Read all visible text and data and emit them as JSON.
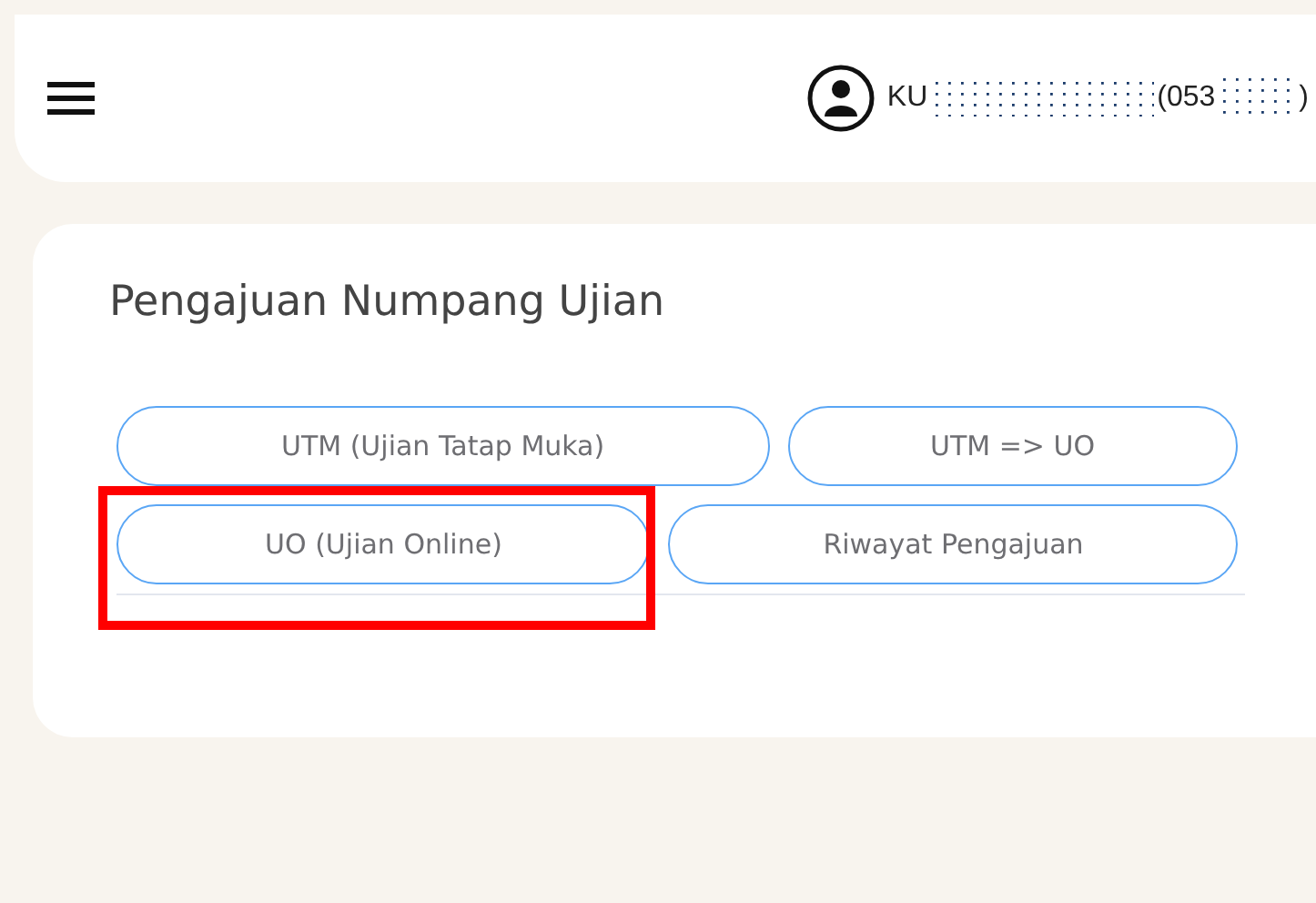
{
  "header": {
    "user_name": "KU",
    "user_code": "(053",
    "user_code_end": ")"
  },
  "card": {
    "title": "Pengajuan Numpang Ujian",
    "button_rows": [
      [
        {
          "label": "UTM (Ujian Tatap Muka)",
          "highlighted": false
        },
        {
          "label": "UTM => UO",
          "highlighted": false
        }
      ],
      [
        {
          "label": "UO (Ujian Online)",
          "highlighted": true
        },
        {
          "label": "Riwayat Pengajuan",
          "highlighted": false
        }
      ]
    ]
  }
}
